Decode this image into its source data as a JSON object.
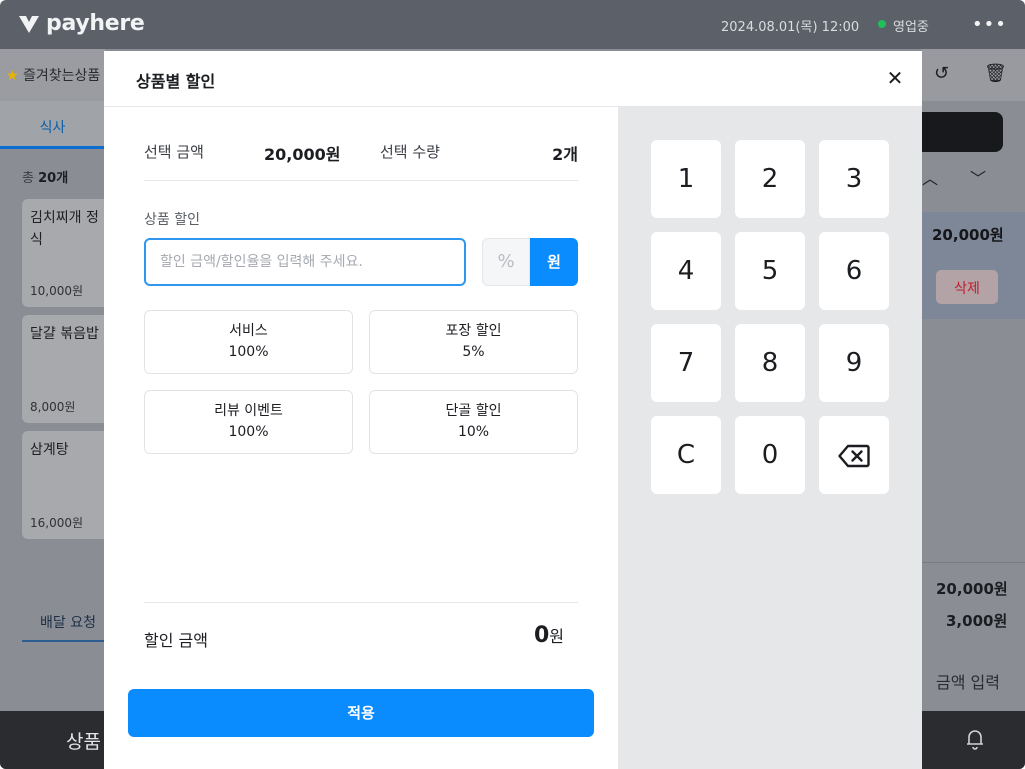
{
  "topbar": {
    "logo": "payhere",
    "datetime": "2024.08.01(목) 12:00",
    "status": "영업중",
    "more_icon": "more-icon",
    "status_color": "#1fbf5a"
  },
  "background": {
    "favorites_label": "즐겨찾는상품",
    "category_tab": "식사",
    "total_label": "총",
    "total_count": "20개",
    "menu_items": [
      {
        "name": "김치찌개 정식",
        "price": "10,000원"
      },
      {
        "name": "달걀 볶음밥",
        "price": "8,000원"
      },
      {
        "name": "삼계탕",
        "price": "16,000원"
      }
    ],
    "delivery_tab": "배달 요청",
    "bottom_label": "상품",
    "selected_price": "20,000원",
    "delete_label": "삭제",
    "summary_total": "20,000원",
    "summary_sub": "3,000원",
    "amount_input_label": "금액 입력"
  },
  "modal": {
    "title": "상품별 할인",
    "selected_amount_label": "선택 금액",
    "selected_amount_value": "20,000원",
    "selected_qty_label": "선택 수량",
    "selected_qty_value": "2개",
    "discount_section_label": "상품 할인",
    "discount_input_placeholder": "할인 금액/할인율을 입력해 주세요.",
    "unit_percent": "%",
    "unit_won": "원",
    "presets": [
      {
        "name": "서비스",
        "value": "100%"
      },
      {
        "name": "포장 할인",
        "value": "5%"
      },
      {
        "name": "리뷰 이벤트",
        "value": "100%"
      },
      {
        "name": "단골 할인",
        "value": "10%"
      }
    ],
    "discount_amount_label": "할인 금액",
    "discount_amount_value": "0",
    "discount_amount_unit": "원",
    "apply_label": "적용",
    "accent_color": "#0a8cff"
  },
  "keypad": {
    "keys": [
      "1",
      "2",
      "3",
      "4",
      "5",
      "6",
      "7",
      "8",
      "9",
      "C",
      "0"
    ],
    "backspace_icon": "backspace-icon"
  }
}
